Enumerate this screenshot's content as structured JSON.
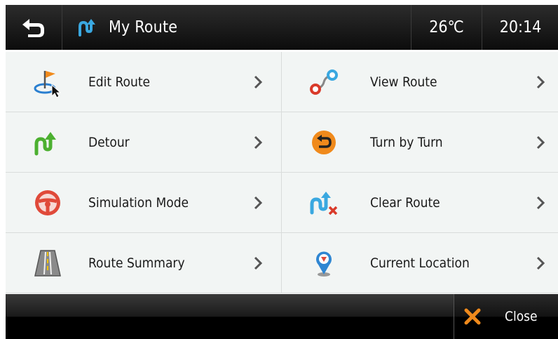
{
  "header": {
    "title": "My Route",
    "temperature": "26℃",
    "time": "20:14",
    "back_icon": "back-arrow-icon",
    "title_icon": "route-icon"
  },
  "menu": {
    "items": [
      {
        "label": "Edit Route",
        "icon": "edit-route-flag-icon"
      },
      {
        "label": "View Route",
        "icon": "view-route-icon"
      },
      {
        "label": "Detour",
        "icon": "detour-icon"
      },
      {
        "label": "Turn by Turn",
        "icon": "turn-by-turn-icon"
      },
      {
        "label": "Simulation Mode",
        "icon": "steering-wheel-icon"
      },
      {
        "label": "Clear Route",
        "icon": "clear-route-icon"
      },
      {
        "label": "Route Summary",
        "icon": "road-icon"
      },
      {
        "label": "Current Location",
        "icon": "location-pin-icon"
      }
    ]
  },
  "footer": {
    "close_label": "Close"
  },
  "colors": {
    "header_bg": "#111111",
    "list_bg": "#f2f5f4",
    "accent_blue": "#3aa8e0",
    "accent_orange": "#f08a1c"
  }
}
